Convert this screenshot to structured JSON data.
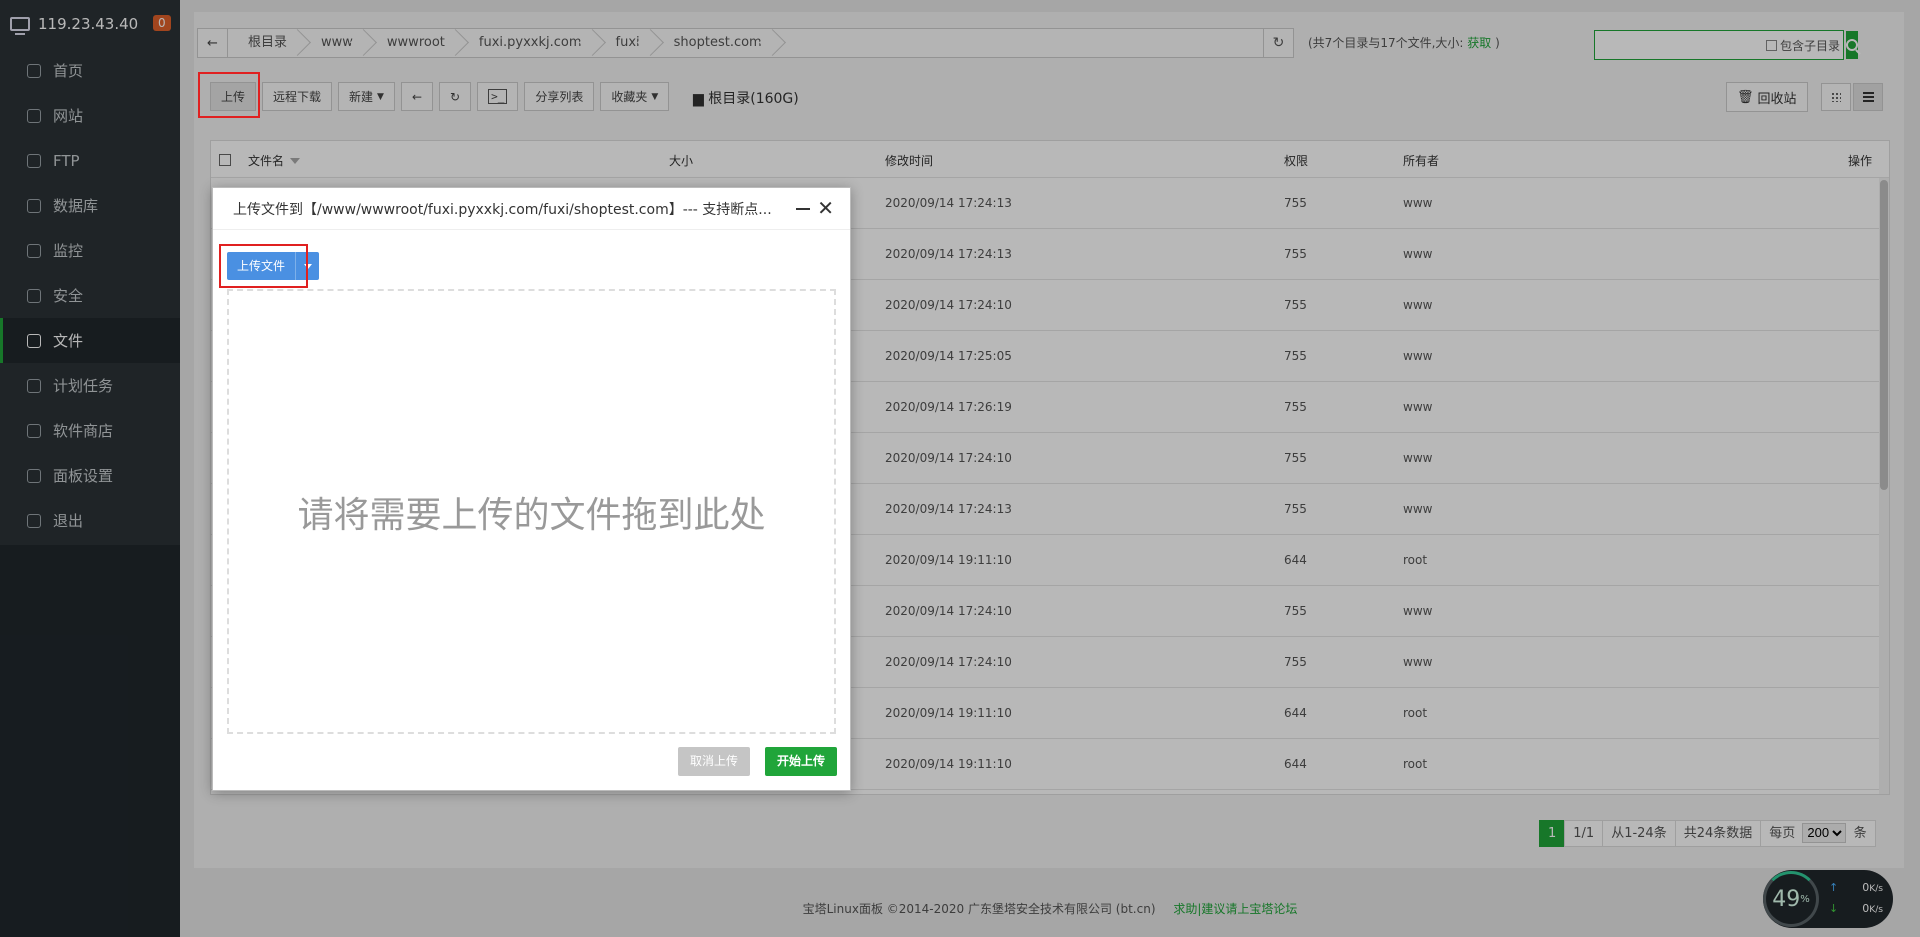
{
  "server": {
    "ip": "119.23.43.40",
    "badge": "0"
  },
  "nav": [
    {
      "label": "首页",
      "icon": "home-icon"
    },
    {
      "label": "网站",
      "icon": "globe-icon"
    },
    {
      "label": "FTP",
      "icon": "ftp-icon"
    },
    {
      "label": "数据库",
      "icon": "database-icon"
    },
    {
      "label": "监控",
      "icon": "monitor-icon"
    },
    {
      "label": "安全",
      "icon": "shield-icon"
    },
    {
      "label": "文件",
      "icon": "folder-icon",
      "active": true
    },
    {
      "label": "计划任务",
      "icon": "clock-icon"
    },
    {
      "label": "软件商店",
      "icon": "grid-icon"
    },
    {
      "label": "面板设置",
      "icon": "gear-icon"
    },
    {
      "label": "退出",
      "icon": "logout-icon"
    }
  ],
  "breadcrumb": [
    "根目录",
    "www",
    "wwwroot",
    "fuxi.pyxxkj.com",
    "fuxi",
    "shoptest.com"
  ],
  "crumb_info": {
    "text": "(共7个目录与17个文件,大小:",
    "link": "获取",
    "end": ")"
  },
  "search": {
    "placeholder": "",
    "sub_dir_label": "包含子目录"
  },
  "toolbar": {
    "upload": "上传",
    "remote_download": "远程下载",
    "new": "新建",
    "share_list": "分享列表",
    "favorites": "收藏夹",
    "disk": "根目录(160G)",
    "recycle": "回收站"
  },
  "table": {
    "headers": {
      "name": "文件名",
      "size": "大小",
      "mtime": "修改时间",
      "perm": "权限",
      "owner": "所有者",
      "ops": "操作"
    },
    "rows": [
      {
        "mtime": "2020/09/14 17:24:13",
        "perm": "755",
        "owner": "www"
      },
      {
        "mtime": "2020/09/14 17:24:13",
        "perm": "755",
        "owner": "www"
      },
      {
        "mtime": "2020/09/14 17:24:10",
        "perm": "755",
        "owner": "www"
      },
      {
        "mtime": "2020/09/14 17:25:05",
        "perm": "755",
        "owner": "www"
      },
      {
        "mtime": "2020/09/14 17:26:19",
        "perm": "755",
        "owner": "www"
      },
      {
        "mtime": "2020/09/14 17:24:10",
        "perm": "755",
        "owner": "www"
      },
      {
        "mtime": "2020/09/14 17:24:13",
        "perm": "755",
        "owner": "www"
      },
      {
        "mtime": "2020/09/14 19:11:10",
        "perm": "644",
        "owner": "root"
      },
      {
        "mtime": "2020/09/14 17:24:10",
        "perm": "755",
        "owner": "www"
      },
      {
        "mtime": "2020/09/14 17:24:10",
        "perm": "755",
        "owner": "www"
      },
      {
        "mtime": "2020/09/14 19:11:10",
        "perm": "644",
        "owner": "root"
      },
      {
        "mtime": "2020/09/14 19:11:10",
        "perm": "644",
        "owner": "root"
      }
    ]
  },
  "pagination": {
    "current": "1",
    "pages": "1/1",
    "range": "从1-24条",
    "total": "共24条数据",
    "per_page_label": "每页",
    "per_page": "200",
    "unit": "条"
  },
  "footer": {
    "copyright": "宝塔Linux面板 ©2014-2020 广东堡塔安全技术有限公司 (bt.cn)",
    "link": "求助|建议请上宝塔论坛"
  },
  "speed": {
    "percent": "49",
    "unit": "%",
    "up": "0",
    "down": "0",
    "rate_unit": "K/s"
  },
  "dialog": {
    "title": "上传文件到【/www/wwwroot/fuxi.pyxxkj.com/fuxi/shoptest.com】--- 支持断点...",
    "upload_file": "上传文件",
    "drop_hint": "请将需要上传的文件拖到此处",
    "cancel": "取消上传",
    "start": "开始上传"
  },
  "colors": {
    "accent": "#20a53a",
    "sidebar": "#2b3236",
    "highlight": "#e02020",
    "upload_blue": "#4a90e2"
  }
}
